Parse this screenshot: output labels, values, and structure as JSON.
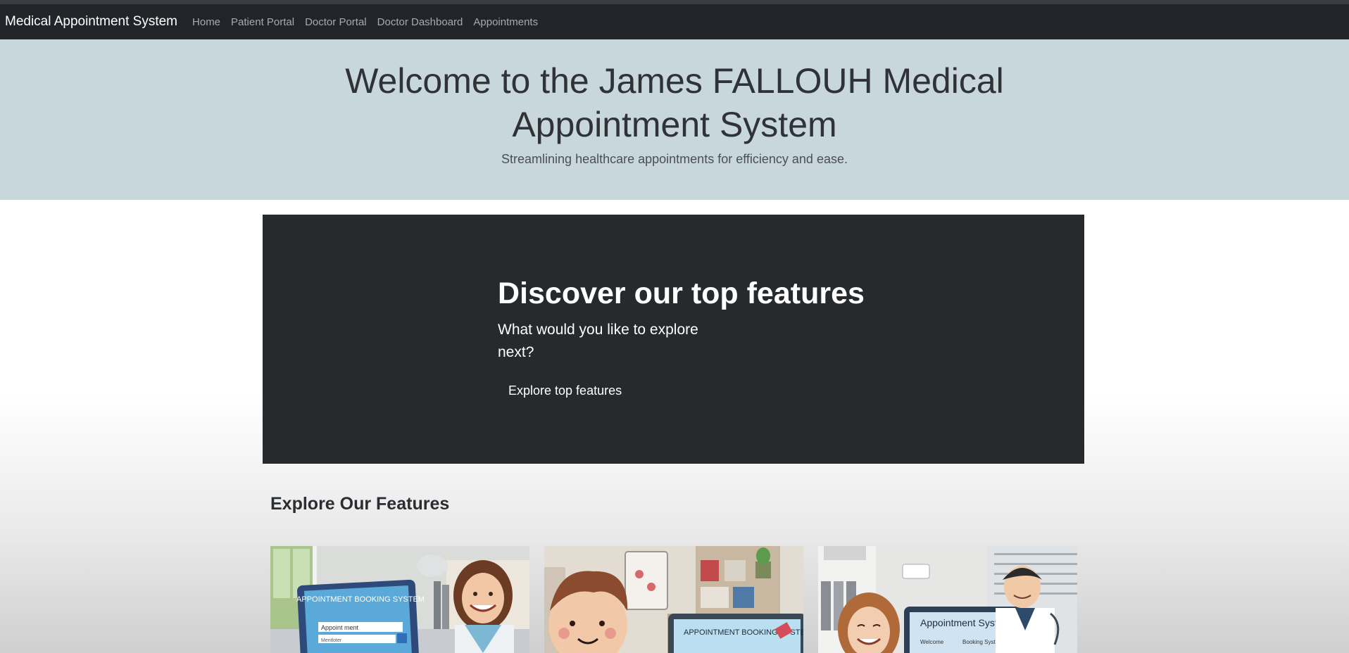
{
  "navbar": {
    "brand": "Medical Appointment System",
    "links": [
      {
        "label": "Home"
      },
      {
        "label": "Patient Portal"
      },
      {
        "label": "Doctor Portal"
      },
      {
        "label": "Doctor Dashboard"
      },
      {
        "label": "Appointments"
      }
    ]
  },
  "hero": {
    "title": "Welcome to the James FALLOUH Medical Appointment System",
    "subtitle": "Streamlining healthcare appointments for efficiency and ease."
  },
  "feature_banner": {
    "title": "Discover our top features",
    "lead": "What would you like to explore next?",
    "button_label": "Explore top features"
  },
  "features_section": {
    "title": "Explore Our Features",
    "cards": [
      {
        "screen_title": "APPOINTMENT BOOKING SYSTEM",
        "field1": "Appoint ment",
        "field2": "Mentloter"
      },
      {
        "screen_title": "APPOINTMENT BOOKING SYSTEM"
      },
      {
        "screen_title": "Appointment System",
        "field1": "Welcome",
        "field2": "Booking System"
      }
    ]
  },
  "colors": {
    "navbar_bg": "#212529",
    "hero_bg": "#c7d7dc",
    "banner_bg": "#262a2d"
  }
}
